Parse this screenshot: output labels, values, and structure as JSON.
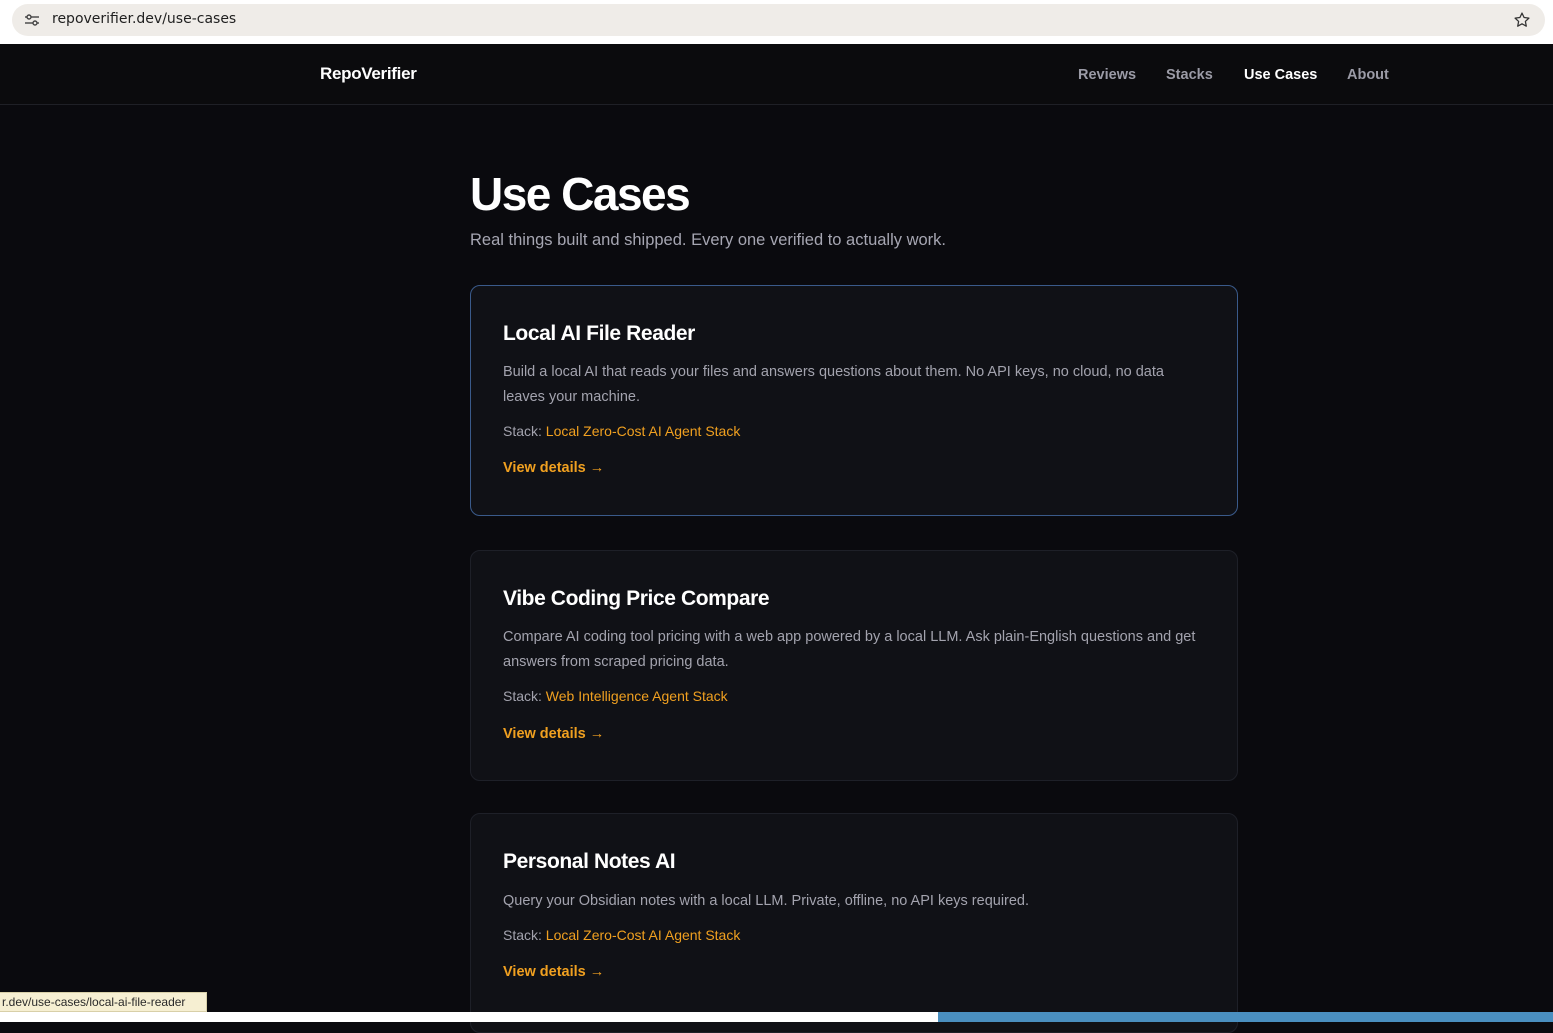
{
  "browser": {
    "url": "repoverifier.dev/use-cases",
    "status_url": "r.dev/use-cases/local-ai-file-reader"
  },
  "header": {
    "logo": "RepoVerifier",
    "nav": [
      {
        "label": "Reviews"
      },
      {
        "label": "Stacks"
      },
      {
        "label": "Use Cases",
        "active": true
      },
      {
        "label": "About"
      }
    ]
  },
  "main": {
    "title": "Use Cases",
    "subtitle": "Real things built and shipped. Every one verified to actually work.",
    "stack_prefix": "Stack:",
    "cards": [
      {
        "title": "Local AI File Reader",
        "description": "Build a local AI that reads your files and answers questions about them. No API keys, no cloud, no data leaves your machine.",
        "stack": "Local Zero-Cost AI Agent Stack",
        "link_label": "View details →"
      },
      {
        "title": "Vibe Coding Price Compare",
        "description": "Compare AI coding tool pricing with a web app powered by a local LLM. Ask plain-English questions and get answers from scraped pricing data.",
        "stack": "Web Intelligence Agent Stack",
        "link_label": "View details →"
      },
      {
        "title": "Personal Notes AI",
        "description": "Query your Obsidian notes with a local LLM. Private, offline, no API keys required.",
        "stack": "Local Zero-Cost AI Agent Stack",
        "link_label": "View details →"
      }
    ]
  },
  "colors": {
    "accent": "#f0a020",
    "background": "#0a0a0e",
    "card": "#101116",
    "highlight_border": "#3a5a8a"
  }
}
